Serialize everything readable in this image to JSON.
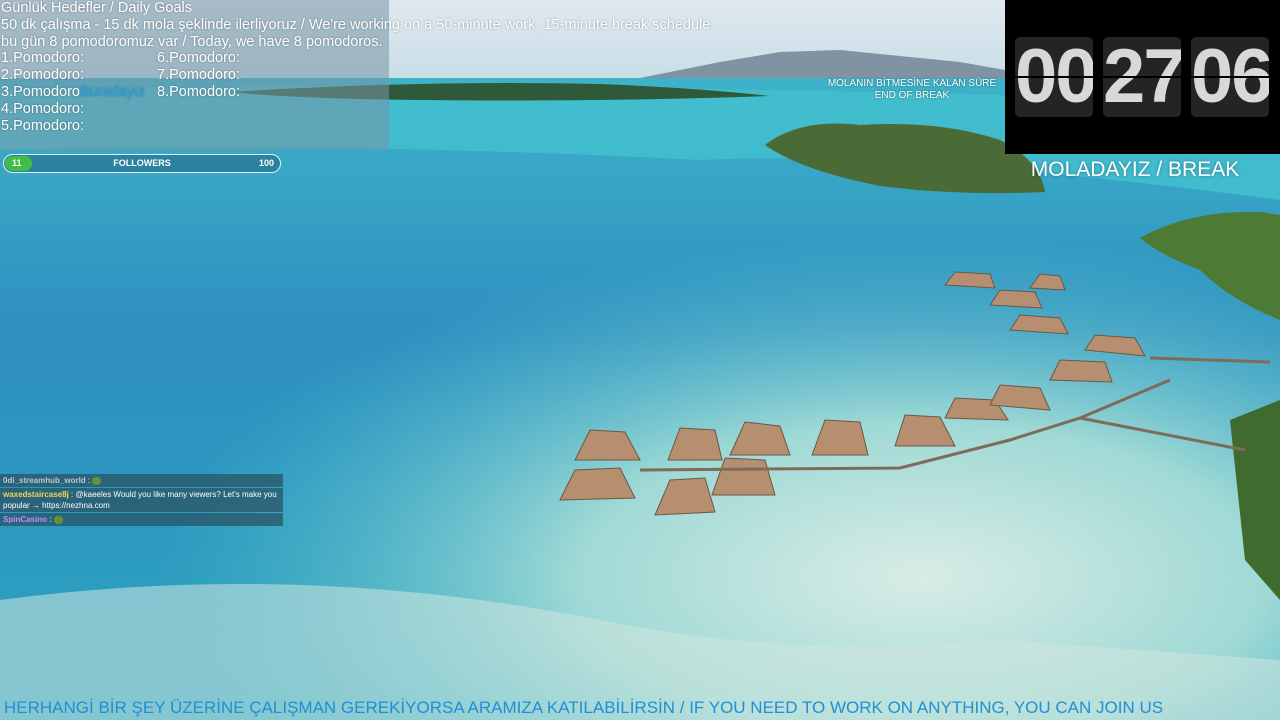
{
  "goals": {
    "title": "Günlük Hedefler / Daily Goals",
    "schedule": "50 dk çalışma - 15 dk mola şeklinde ilerliyoruz / We're working on a 50-minute work, 15-minute break schedule.",
    "today": "bu gün 8 pomodoromuz var / Today, we have 8 pomodoros.",
    "pomodoros_left": [
      "1.Pomodoro:",
      "2.Pomodoro:",
      "3.Pomodoro",
      "4.Pomodoro:",
      "5.Pomodoro:"
    ],
    "pomodoros_right": [
      "6.Pomodoro:",
      "7.Pomodoro:",
      "8.Pomodoro:"
    ],
    "current_marker": "Buradayız"
  },
  "followers": {
    "current": "11",
    "label": "FOLLOWERS",
    "goal": "100",
    "progress": 0.11,
    "fill_color": "#3fbf4a"
  },
  "timer": {
    "caption_line1": "MOLANIN BİTMESİNE KALAN SÜRE",
    "caption_line2": "END OF BREAK",
    "hours": "00",
    "minutes": "27",
    "seconds": "06",
    "status": "MOLADAYIZ / BREAK"
  },
  "chat": [
    {
      "user": "0di_streamhub_world",
      "user_color": "#b9c7d0",
      "text": "",
      "emote": "frog-emote"
    },
    {
      "user": "waxedstaircase8j",
      "user_color": "#f2d35a",
      "text": "@kaeeles Would you like many viewers? Let's make you popular → https://nezhna.com",
      "emote": ""
    },
    {
      "user": "SpinCasino",
      "user_color": "#c58cf0",
      "text": "",
      "emote": "frog-emote"
    }
  ],
  "ticker": {
    "text": "HERHANGİ BİR ŞEY ÜZERİNE ÇALIŞMAN GEREKİYORSA ARAMIZA KATILABİLİRSİN / IF YOU NEED TO WORK ON ANYTHING, YOU CAN JOIN US",
    "color": "#1f8fd6"
  }
}
